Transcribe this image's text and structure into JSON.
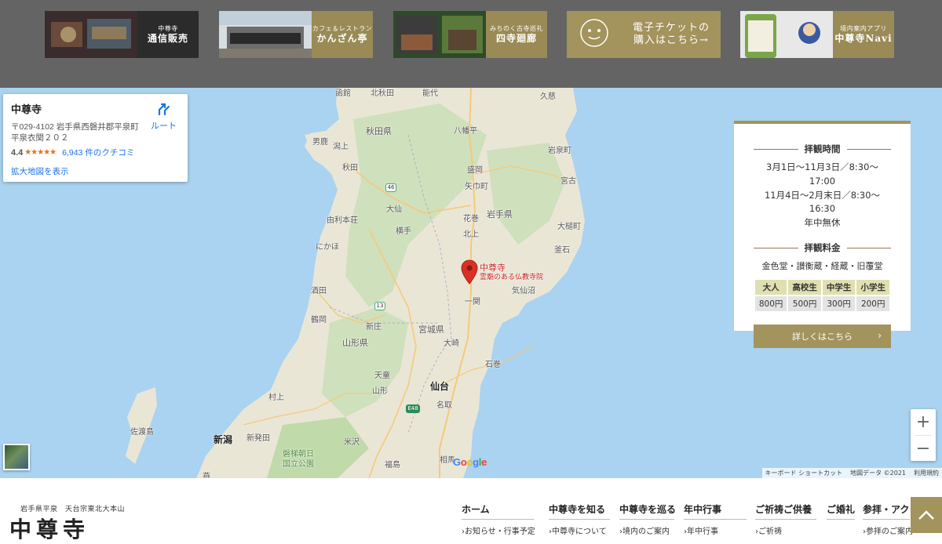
{
  "banners": [
    {
      "small": "中尊寺",
      "big": "通信販売"
    },
    {
      "small": "カフェ＆レストラン",
      "big": "かんざん亭"
    },
    {
      "small": "みちのく古寺巡礼",
      "big": "四寺廻廊"
    },
    {
      "line1": "電子チケットの",
      "line2": "購入はこちら→"
    },
    {
      "small": "境内案内アプリ",
      "big": "中尊寺Navi"
    }
  ],
  "map": {
    "labels": {
      "hakodate": "函館",
      "omagari": "北秋田",
      "noshiro": "能代",
      "kuji": "久慈",
      "akita_pref": "秋田県",
      "hachimantai": "八幡平",
      "oga": "男鹿",
      "katagami": "潟上",
      "miyako_north": "岩泉町",
      "akita": "秋田",
      "morioka": "盛岡",
      "yahaba": "矢巾町",
      "miyako": "宮古",
      "daisen": "大仙",
      "hanamaki": "花巻",
      "iwate_pref": "岩手県",
      "yurihonjo": "由利本荘",
      "yokote": "横手",
      "kitakami": "北上",
      "otsuchi": "大槌町",
      "nikaho": "にかほ",
      "kamaishi": "釜石",
      "sakata": "酒田",
      "kesennuma": "気仙沼",
      "ichinoseki": "一関",
      "tsuruoka": "鶴岡",
      "shinjo": "新庄",
      "miyagi_pref": "宮城県",
      "yamagata_pref": "山形県",
      "osaki": "大崎",
      "ishinomaki": "石巻",
      "tendo": "天童",
      "yamagata": "山形",
      "sendai": "仙台",
      "murakami": "村上",
      "natori": "名取",
      "sado": "佐渡島",
      "niigata": "新潟",
      "shibata": "新発田",
      "yonezawa": "米沢",
      "bandai": "磐梯朝日",
      "bandai2": "国立公園",
      "fukushima": "福島",
      "soma": "相馬",
      "kamo": "燕"
    },
    "routes": {
      "r46": "46",
      "r13": "13",
      "e48": "E48"
    },
    "marker": {
      "name": "中尊寺",
      "sub": "霊廟のある仏教寺院"
    },
    "place_card": {
      "name": "中尊寺",
      "address": "〒029-4102 岩手県西磐井郡平泉町平泉衣関２０２",
      "rating": "4.4",
      "stars": "★★★★★",
      "reviews": "6,943 件のクチコミ",
      "larger_map": "拡大地図を表示",
      "route": "ルート"
    },
    "zoom_in": "+",
    "zoom_out": "−",
    "google": "Google",
    "attribution": [
      "キーボード ショートカット",
      "地図データ ©2021",
      "利用規約"
    ]
  },
  "info_panel": {
    "hours_title": "拝観時間",
    "hours": [
      "3月1日〜11月3日／8:30〜17:00",
      "11月4日〜2月末日／8:30〜16:30",
      "年中無休"
    ],
    "fee_title": "拝観料金",
    "fee_sub": "金色堂・讃衡蔵・経蔵・旧覆堂",
    "fee_headers": [
      "大人",
      "高校生",
      "中学生",
      "小学生"
    ],
    "fee_values": [
      "800円",
      "500円",
      "300円",
      "200円"
    ],
    "more": "詳しくはこちら"
  },
  "footer": {
    "tagline": "岩手県平泉　天台宗東北大本山",
    "logo": "中尊寺",
    "nav": [
      {
        "head": "ホーム",
        "sub": "お知らせ・行事予定"
      },
      {
        "head": "中尊寺を知る",
        "sub": "中尊寺について"
      },
      {
        "head": "中尊寺を巡る",
        "sub": "境内のご案内"
      },
      {
        "head": "年中行事",
        "sub": "年中行事"
      },
      {
        "head": "ご祈祷ご供養",
        "sub": "ご祈祷"
      },
      {
        "head": "ご婚礼",
        "sub": ""
      },
      {
        "head": "参拝・アクセス",
        "sub": "参拝のご案内"
      }
    ]
  },
  "colors": {
    "gold": "#a3935c",
    "banner_bg": "#646464",
    "sea": "#a9d3f0",
    "marker": "#d93025"
  }
}
